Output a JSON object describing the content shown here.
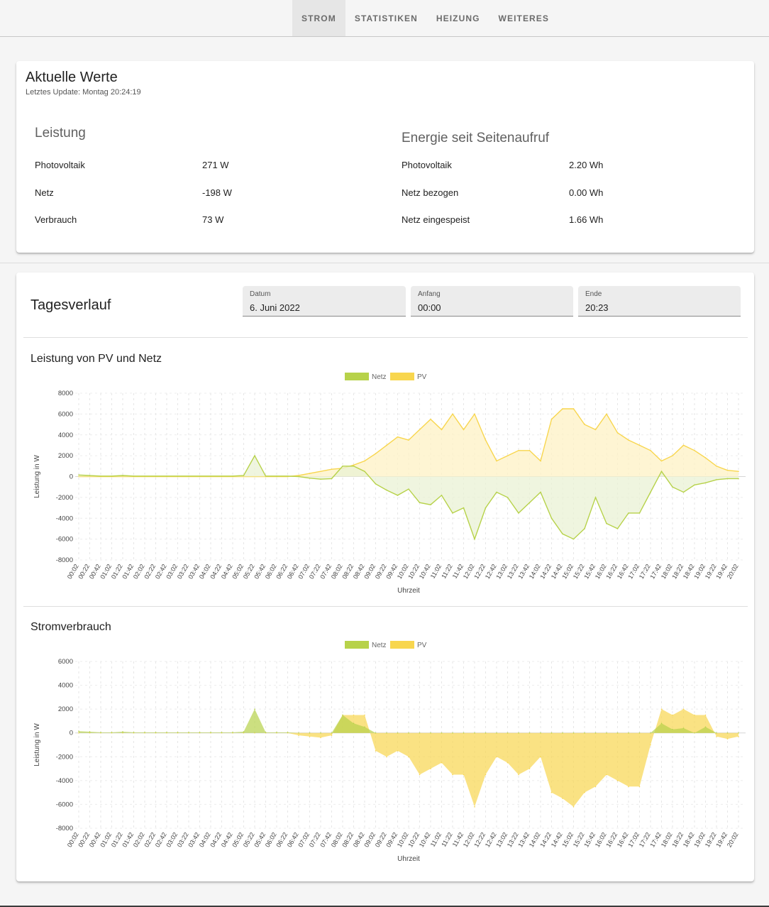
{
  "nav": {
    "tabs": [
      {
        "label": "STROM",
        "active": true
      },
      {
        "label": "STATISTIKEN",
        "active": false
      },
      {
        "label": "HEIZUNG",
        "active": false
      },
      {
        "label": "WEITERES",
        "active": false
      }
    ]
  },
  "current": {
    "title": "Aktuelle Werte",
    "last_update": "Letztes Update: Montag 20:24:19",
    "power": {
      "title": "Leistung",
      "rows": [
        {
          "label": "Photovoltaik",
          "value": "271 W"
        },
        {
          "label": "Netz",
          "value": "-198 W"
        },
        {
          "label": "Verbrauch",
          "value": "73 W"
        }
      ]
    },
    "energy": {
      "title": "Energie seit Seitenaufruf",
      "rows": [
        {
          "label": "Photovoltaik",
          "value": "2.20 Wh"
        },
        {
          "label": "Netz bezogen",
          "value": "0.00 Wh"
        },
        {
          "label": "Netz eingespeist",
          "value": "1.66 Wh"
        }
      ]
    }
  },
  "daily": {
    "title": "Tagesverlauf",
    "date": {
      "label": "Datum",
      "value": "6. Juni 2022"
    },
    "start": {
      "label": "Anfang",
      "value": "00:00"
    },
    "end": {
      "label": "Ende",
      "value": "20:23"
    }
  },
  "colors": {
    "netz": "#b7d24a",
    "pv": "#f8d64e",
    "netz_fill": "#eaf2d4",
    "pv_fill": "#fdf1c4"
  },
  "chart_data": [
    {
      "type": "line",
      "title": "Leistung von PV und Netz",
      "xlabel": "Uhrzeit",
      "ylabel": "Leistung in W",
      "ylim": [
        -8000,
        8000
      ],
      "yticks": [
        8000,
        6000,
        4000,
        2000,
        0,
        -2000,
        -4000,
        -6000,
        -8000
      ],
      "legend": "top-center",
      "grid": true,
      "x": [
        "00:02",
        "00:22",
        "00:42",
        "01:02",
        "01:22",
        "01:42",
        "02:02",
        "02:22",
        "02:42",
        "03:02",
        "03:22",
        "03:42",
        "04:02",
        "04:22",
        "04:42",
        "05:02",
        "05:22",
        "05:42",
        "06:02",
        "06:22",
        "06:42",
        "07:02",
        "07:22",
        "07:42",
        "08:02",
        "08:22",
        "08:42",
        "09:02",
        "09:22",
        "09:42",
        "10:02",
        "10:22",
        "10:42",
        "11:02",
        "11:22",
        "11:42",
        "12:02",
        "12:22",
        "12:42",
        "13:02",
        "13:22",
        "13:42",
        "14:02",
        "14:22",
        "14:42",
        "15:02",
        "15:22",
        "15:42",
        "16:02",
        "16:22",
        "16:42",
        "17:02",
        "17:22",
        "17:42",
        "18:02",
        "18:22",
        "18:42",
        "19:02",
        "19:22",
        "19:42",
        "20:02"
      ],
      "series": [
        {
          "name": "Netz",
          "values": [
            150,
            100,
            50,
            50,
            100,
            50,
            50,
            50,
            50,
            50,
            50,
            50,
            50,
            50,
            50,
            100,
            2000,
            50,
            50,
            50,
            0,
            -150,
            -250,
            -200,
            1000,
            1000,
            500,
            -700,
            -1300,
            -1800,
            -1200,
            -2500,
            -2700,
            -1800,
            -3500,
            -3000,
            -6000,
            -3000,
            -1500,
            -2000,
            -3500,
            -2500,
            -1500,
            -4000,
            -5500,
            -6000,
            -5000,
            -2000,
            -4500,
            -5000,
            -3500,
            -3500,
            -1500,
            500,
            -1000,
            -1500,
            -800,
            -600,
            -300,
            -200,
            -200
          ]
        },
        {
          "name": "PV",
          "values": [
            0,
            0,
            0,
            0,
            0,
            0,
            0,
            0,
            0,
            0,
            0,
            0,
            0,
            0,
            0,
            0,
            0,
            0,
            0,
            0,
            100,
            300,
            500,
            700,
            800,
            1100,
            1500,
            2200,
            3000,
            3800,
            3500,
            4500,
            5500,
            4500,
            6000,
            4500,
            6000,
            3500,
            1500,
            2000,
            2500,
            2500,
            1500,
            5500,
            6500,
            6500,
            5000,
            4500,
            6000,
            4200,
            3500,
            3000,
            2500,
            1500,
            2000,
            3000,
            2500,
            1800,
            1000,
            600,
            500
          ]
        }
      ]
    },
    {
      "type": "area",
      "title": "Stromverbrauch",
      "xlabel": "Uhrzeit",
      "ylabel": "Leistung in W",
      "ylim": [
        -8000,
        6000
      ],
      "yticks": [
        6000,
        4000,
        2000,
        0,
        -2000,
        -4000,
        -6000,
        -8000
      ],
      "legend": "top-center",
      "grid": true,
      "x": [
        "00:02",
        "00:22",
        "00:42",
        "01:02",
        "01:22",
        "01:42",
        "02:02",
        "02:22",
        "02:42",
        "03:02",
        "03:22",
        "03:42",
        "04:02",
        "04:22",
        "04:42",
        "05:02",
        "05:22",
        "05:42",
        "06:02",
        "06:22",
        "06:42",
        "07:02",
        "07:22",
        "07:42",
        "08:02",
        "08:22",
        "08:42",
        "09:02",
        "09:22",
        "09:42",
        "10:02",
        "10:22",
        "10:42",
        "11:02",
        "11:22",
        "11:42",
        "12:02",
        "12:22",
        "12:42",
        "13:02",
        "13:22",
        "13:42",
        "14:02",
        "14:22",
        "14:42",
        "15:02",
        "15:22",
        "15:42",
        "16:02",
        "16:22",
        "16:42",
        "17:02",
        "17:22",
        "17:42",
        "18:02",
        "18:22",
        "18:42",
        "19:02",
        "19:22",
        "19:42",
        "20:02"
      ],
      "series": [
        {
          "name": "Netz",
          "values": [
            150,
            100,
            50,
            50,
            100,
            50,
            50,
            50,
            50,
            50,
            50,
            50,
            50,
            50,
            50,
            100,
            2000,
            50,
            50,
            50,
            0,
            0,
            0,
            0,
            1500,
            800,
            500,
            0,
            0,
            0,
            0,
            0,
            0,
            0,
            0,
            0,
            0,
            0,
            0,
            0,
            0,
            0,
            0,
            0,
            0,
            0,
            0,
            0,
            0,
            0,
            0,
            0,
            0,
            800,
            300,
            400,
            0,
            500,
            0,
            0,
            0
          ]
        },
        {
          "name": "PV",
          "values": [
            0,
            0,
            0,
            0,
            0,
            0,
            0,
            0,
            0,
            0,
            0,
            0,
            0,
            0,
            0,
            0,
            0,
            0,
            0,
            0,
            -200,
            -300,
            -400,
            -200,
            1500,
            1500,
            1500,
            -1500,
            -2000,
            -1500,
            -2000,
            -3500,
            -3000,
            -2500,
            -3500,
            -3500,
            -6200,
            -3500,
            -2000,
            -2500,
            -3500,
            -3000,
            -2000,
            -5000,
            -5500,
            -6200,
            -5000,
            -4500,
            -3500,
            -4000,
            -4500,
            -4500,
            -1000,
            2000,
            1500,
            2000,
            1500,
            1500,
            -300,
            -500,
            -300
          ]
        }
      ]
    }
  ]
}
